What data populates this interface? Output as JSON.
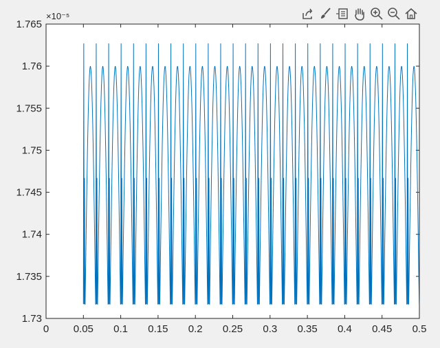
{
  "toolbar": {
    "items": [
      {
        "name": "export-icon"
      },
      {
        "name": "brush-icon"
      },
      {
        "name": "datatip-icon"
      },
      {
        "name": "pan-icon"
      },
      {
        "name": "zoom-in-icon"
      },
      {
        "name": "zoom-out-icon"
      },
      {
        "name": "home-icon"
      }
    ]
  },
  "chart_data": {
    "type": "line",
    "title": "",
    "xlabel": "",
    "ylabel": "",
    "xlim": [
      0,
      0.5
    ],
    "ylim": [
      1.73e-05,
      1.765e-05
    ],
    "y_exponent_label": "×10⁻⁵",
    "x_ticks": [
      "0",
      "0.05",
      "0.1",
      "0.15",
      "0.2",
      "0.25",
      "0.3",
      "0.35",
      "0.4",
      "0.45",
      "0.5"
    ],
    "y_ticks": [
      "1.73",
      "1.735",
      "1.74",
      "1.745",
      "1.75",
      "1.755",
      "1.76",
      "1.765"
    ],
    "grid": false,
    "series": [
      {
        "color": "#0072bd",
        "x_start": 0.05,
        "x_end": 0.5,
        "period": 0.01667,
        "spike_max": 1.7627e-05,
        "smooth_peak": 1.76e-05,
        "trough": 1.7317e-05,
        "step_level": 1.7467e-05
      }
    ]
  },
  "colors": {
    "background": "#f0f0f0",
    "axes_bg": "#ffffff",
    "line": "#0072bd"
  }
}
